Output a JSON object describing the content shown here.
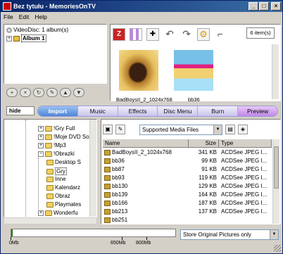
{
  "window": {
    "title": "Bez tytułu - MemoriesOnTV"
  },
  "menu": {
    "file": "File",
    "edit": "Edit",
    "help": "Help"
  },
  "album_tree": {
    "root_label": "VideoDisc: 1 album(s)",
    "album_label": "Album 1",
    "expand_glyph": "+"
  },
  "tree_buttons": [
    "+",
    "×",
    "↻",
    "✎",
    "▲",
    "▼"
  ],
  "preview_panel": {
    "item_count": "6 item(s)",
    "thumbnails": [
      {
        "label": "BadBoysII_2_1024x768"
      },
      {
        "label": "bb36"
      }
    ]
  },
  "tabs": {
    "hide_label": "hide",
    "items": [
      "Import",
      "Music",
      "Effects",
      "Disc Menu",
      "Burn",
      "Preview"
    ],
    "active": "Import"
  },
  "folder_tree": {
    "items": [
      {
        "label": "!Gry Full",
        "expand": "+"
      },
      {
        "label": "!Moje DVD So",
        "expand": "+"
      },
      {
        "label": "!Mp3",
        "expand": "+"
      },
      {
        "label": "!Obrazki",
        "expand": "−"
      },
      {
        "label": "Desktop S"
      },
      {
        "label": "Gry"
      },
      {
        "label": "Inne"
      },
      {
        "label": "Kalendarz"
      },
      {
        "label": "Obraz"
      },
      {
        "label": "Playmates"
      },
      {
        "label": "Wonderfu",
        "expand": "+"
      }
    ]
  },
  "file_list": {
    "filter": "Supported Media Files",
    "columns": {
      "name": "Name",
      "size": "Size",
      "type": "Type"
    },
    "rows": [
      {
        "name": "BadBoysII_2_1024x768",
        "size": "341 KB",
        "type": "ACDSee JPEG I..."
      },
      {
        "name": "bb36",
        "size": "99 KB",
        "type": "ACDSee JPEG I..."
      },
      {
        "name": "bb87",
        "size": "91 KB",
        "type": "ACDSee JPEG I..."
      },
      {
        "name": "bb93",
        "size": "119 KB",
        "type": "ACDSee JPEG I..."
      },
      {
        "name": "bb130",
        "size": "129 KB",
        "type": "ACDSee JPEG I..."
      },
      {
        "name": "bb139",
        "size": "164 KB",
        "type": "ACDSee JPEG I..."
      },
      {
        "name": "bb166",
        "size": "187 KB",
        "type": "ACDSee JPEG I..."
      },
      {
        "name": "bb213",
        "size": "137 KB",
        "type": "ACDSee JPEG I..."
      },
      {
        "name": "bb251",
        "size": "",
        "type": ""
      }
    ]
  },
  "capacity": {
    "used_fraction": 0.01,
    "labels": [
      "0Mb",
      "650Mb",
      "800Mb"
    ],
    "fill_color": "#1d7a1d"
  },
  "store_option": "Store Original Pictures only",
  "icons": {
    "app": "app-icon",
    "disc": "disc-icon",
    "album": "album-icon",
    "folder": "folder-icon",
    "jpg": "jpg-file-icon"
  }
}
